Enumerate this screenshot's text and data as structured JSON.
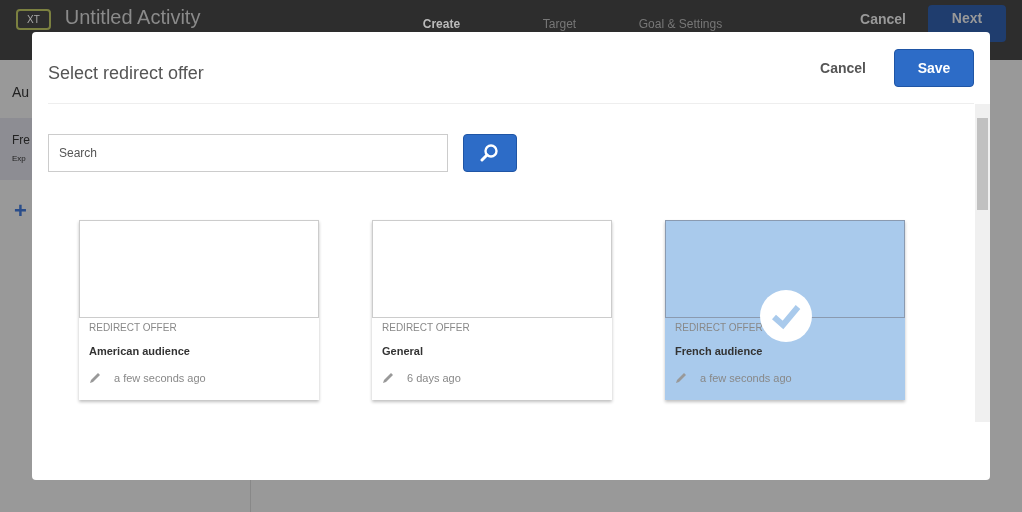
{
  "app_header": {
    "badge": "XT",
    "title": "Untitled Activity",
    "steps": [
      {
        "label": "Create",
        "selected": true
      },
      {
        "label": "Target",
        "selected": false
      },
      {
        "label": "Goal & Settings",
        "selected": false
      }
    ],
    "cancel": "Cancel",
    "next": "Next"
  },
  "sidebar": {
    "heading": "Au",
    "item": {
      "title": "Fre",
      "subtitle": "Exp"
    },
    "add": "+"
  },
  "dialog": {
    "title": "Select redirect offer",
    "cancel": "Cancel",
    "save": "Save",
    "search": {
      "placeholder": "Search"
    },
    "offers": [
      {
        "type": "REDIRECT OFFER",
        "name": "American audience",
        "modified": "a few seconds ago",
        "selected": false
      },
      {
        "type": "REDIRECT OFFER",
        "name": "General",
        "modified": "6 days ago",
        "selected": false
      },
      {
        "type": "REDIRECT OFFER",
        "name": "French audience",
        "modified": "a few seconds ago",
        "selected": true
      }
    ]
  }
}
